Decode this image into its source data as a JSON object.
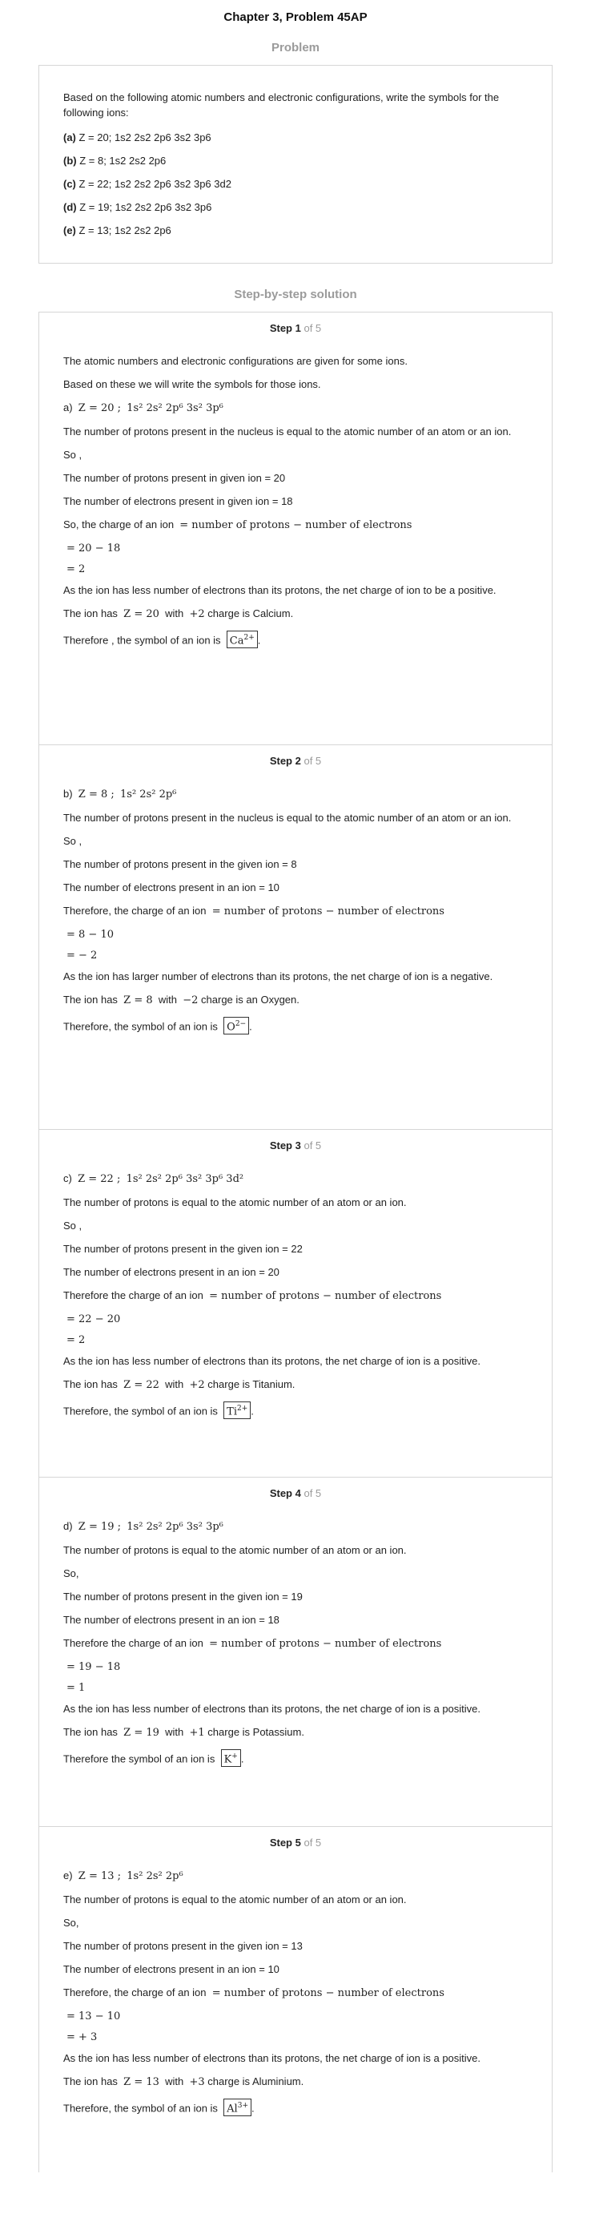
{
  "title": "Chapter 3, Problem 45AP",
  "problem_heading": "Problem",
  "problem": {
    "intro": "Based on the following atomic numbers and electronic configurations, write the symbols for the following ions:",
    "items": [
      {
        "label": "(a)",
        "text": " Z = 20; 1s2 2s2 2p6 3s2 3p6"
      },
      {
        "label": "(b)",
        "text": " Z = 8; 1s2 2s2 2p6"
      },
      {
        "label": "(c)",
        "text": " Z = 22; 1s2 2s2 2p6 3s2 3p6 3d2"
      },
      {
        "label": "(d)",
        "text": " Z = 19; 1s2 2s2 2p6 3s2 3p6"
      },
      {
        "label": "(e)",
        "text": " Z = 13; 1s2 2s2 2p6"
      }
    ]
  },
  "solution_heading": "Step-by-step solution",
  "steps": [
    {
      "step_label": "Step 1",
      "of_label": "of 5",
      "intro1": "The atomic numbers and electronic configurations are given for some ions.",
      "intro2": "Based on these we will write the symbols for those ions.",
      "part": "a)",
      "z_eq": "Z = 20 ;",
      "config": "1s² 2s² 2p⁶ 3s² 3p⁶",
      "l1": "The number of protons present in the nucleus is equal to the atomic number of an atom or an ion.",
      "l2": "So ,",
      "l3": "The number of protons present in given ion = 20",
      "l4": "The number of electrons present in given ion = 18",
      "charge_text": "So, the charge of an ion",
      "charge_formula": "= number of protons − number of electrons",
      "eq1": "= 20 − 18",
      "eq2": "= 2",
      "l5": "As the ion has less number of electrons than its protons, the net charge of ion to be a positive.",
      "ion_has": "The ion has",
      "ion_z": "Z = 20",
      "with": "with",
      "ion_charge": "+2",
      "ion_name": "charge is Calcium.",
      "symbol_text": "Therefore , the symbol of an ion is",
      "symbol": "Ca",
      "symbol_sup": "2+"
    },
    {
      "step_label": "Step 2",
      "of_label": "of 5",
      "part": "b)",
      "z_eq": "Z = 8 ;",
      "config": "1s² 2s² 2p⁶",
      "l1": "The number of protons present in the nucleus is equal to the atomic number of an atom or an ion.",
      "l2": "So ,",
      "l3": "The number of protons present in the given ion = 8",
      "l4": "The number of electrons present in an ion = 10",
      "charge_text": "Therefore, the charge of an ion",
      "charge_formula": "= number of protons − number of electrons",
      "eq1": "= 8 − 10",
      "eq2": "= − 2",
      "l5": "As the ion has larger number of electrons than its protons, the net charge of ion is a negative.",
      "ion_has": "The ion has",
      "ion_z": "Z = 8",
      "with": "with",
      "ion_charge": "−2",
      "ion_name": "charge is an Oxygen.",
      "symbol_text": "Therefore, the symbol of an ion is",
      "symbol": "O",
      "symbol_sup": "2−"
    },
    {
      "step_label": "Step 3",
      "of_label": "of 5",
      "part": "c)",
      "z_eq": "Z = 22 ;",
      "config": "1s² 2s² 2p⁶ 3s² 3p⁶ 3d²",
      "l1": "The number of protons is equal to the atomic number of an atom or an ion.",
      "l2": "So ,",
      "l3": "The number of protons present in the given ion = 22",
      "l4": "The number of electrons present in an ion = 20",
      "charge_text": "Therefore the charge of an ion",
      "charge_formula": "= number of protons − number of electrons",
      "eq1": "= 22 − 20",
      "eq2": "= 2",
      "l5": "As the ion has less number of electrons than its protons, the net charge of ion is a positive.",
      "ion_has": "The ion has",
      "ion_z": "Z = 22",
      "with": "with",
      "ion_charge": "+2",
      "ion_name": "charge is Titanium.",
      "symbol_text": "Therefore, the symbol of an ion is",
      "symbol": "Ti",
      "symbol_sup": "2+"
    },
    {
      "step_label": "Step 4",
      "of_label": "of 5",
      "part": "d)",
      "z_eq": "Z = 19 ;",
      "config": "1s² 2s² 2p⁶ 3s² 3p⁶",
      "l1": "The number of protons is equal to the atomic number of an atom or an ion.",
      "l2": "So,",
      "l3": "The number of protons present in the given ion = 19",
      "l4": "The number of electrons present in an ion = 18",
      "charge_text": "Therefore the charge of an ion",
      "charge_formula": "= number of protons − number of electrons",
      "eq1": "= 19 − 18",
      "eq2": "= 1",
      "l5": "As the ion has less number of electrons than its protons, the net charge of ion is a positive.",
      "ion_has": "The ion has",
      "ion_z": "Z = 19",
      "with": "with",
      "ion_charge": "+1",
      "ion_name": "charge is Potassium.",
      "symbol_text": "Therefore the symbol of an ion is",
      "symbol": "K",
      "symbol_sup": "+"
    },
    {
      "step_label": "Step 5",
      "of_label": "of 5",
      "part": "e)",
      "z_eq": "Z = 13 ;",
      "config": "1s² 2s² 2p⁶",
      "l1": "The number of protons is equal to the atomic number of an atom or an ion.",
      "l2": "So,",
      "l3": "The number of protons present in the given ion = 13",
      "l4": "The number of electrons present in an ion = 10",
      "charge_text": "Therefore, the charge of an ion",
      "charge_formula": "= number of protons − number of electrons",
      "eq1": "= 13 − 10",
      "eq2": "= + 3",
      "l5": "As the ion has less number of electrons than its protons, the net charge of ion is a positive.",
      "ion_has": "The ion has",
      "ion_z": "Z = 13",
      "with": "with",
      "ion_charge": "+3",
      "ion_name": "charge is Aluminium.",
      "symbol_text": "Therefore, the symbol of an ion is",
      "symbol": "Al",
      "symbol_sup": "3+"
    }
  ]
}
